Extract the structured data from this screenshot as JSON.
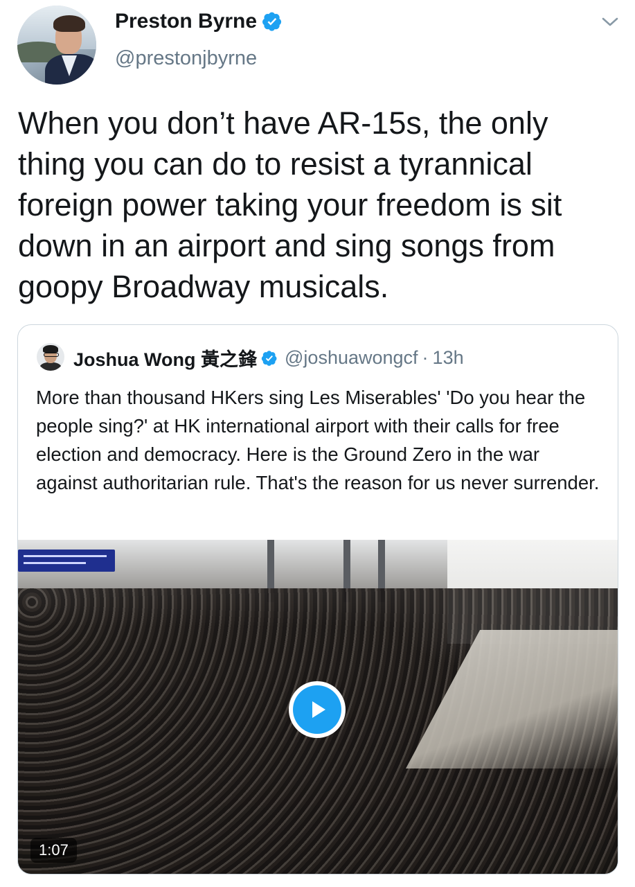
{
  "author": {
    "display_name": "Preston Byrne",
    "handle": "@prestonjbyrne",
    "verified": true,
    "avatar_icon": "profile-photo"
  },
  "tweet": {
    "text": "When you don’t have AR-15s, the only thing you can do to resist a tyrannical foreign power taking your freedom is sit down in an airport and sing songs from goopy Broadway musicals."
  },
  "menu_icon": "chevron-down-icon",
  "quoted": {
    "display_name": "Joshua Wong 黃之鋒",
    "handle": "@joshuawongcf",
    "separator": "·",
    "time": "13h",
    "verified": true,
    "text": "More than thousand HKers sing Les Miserables' 'Do you hear the people sing?' at HK international airport with their calls for free election and democracy. Here is the Ground Zero in the war against authoritarian rule. That's the reason for us never surrender.",
    "media": {
      "type": "video",
      "duration": "1:07",
      "play_icon": "play-icon"
    }
  },
  "colors": {
    "accent": "#1da1f2",
    "text_primary": "#14171a",
    "text_secondary": "#657786",
    "border": "#ccd6dd"
  }
}
